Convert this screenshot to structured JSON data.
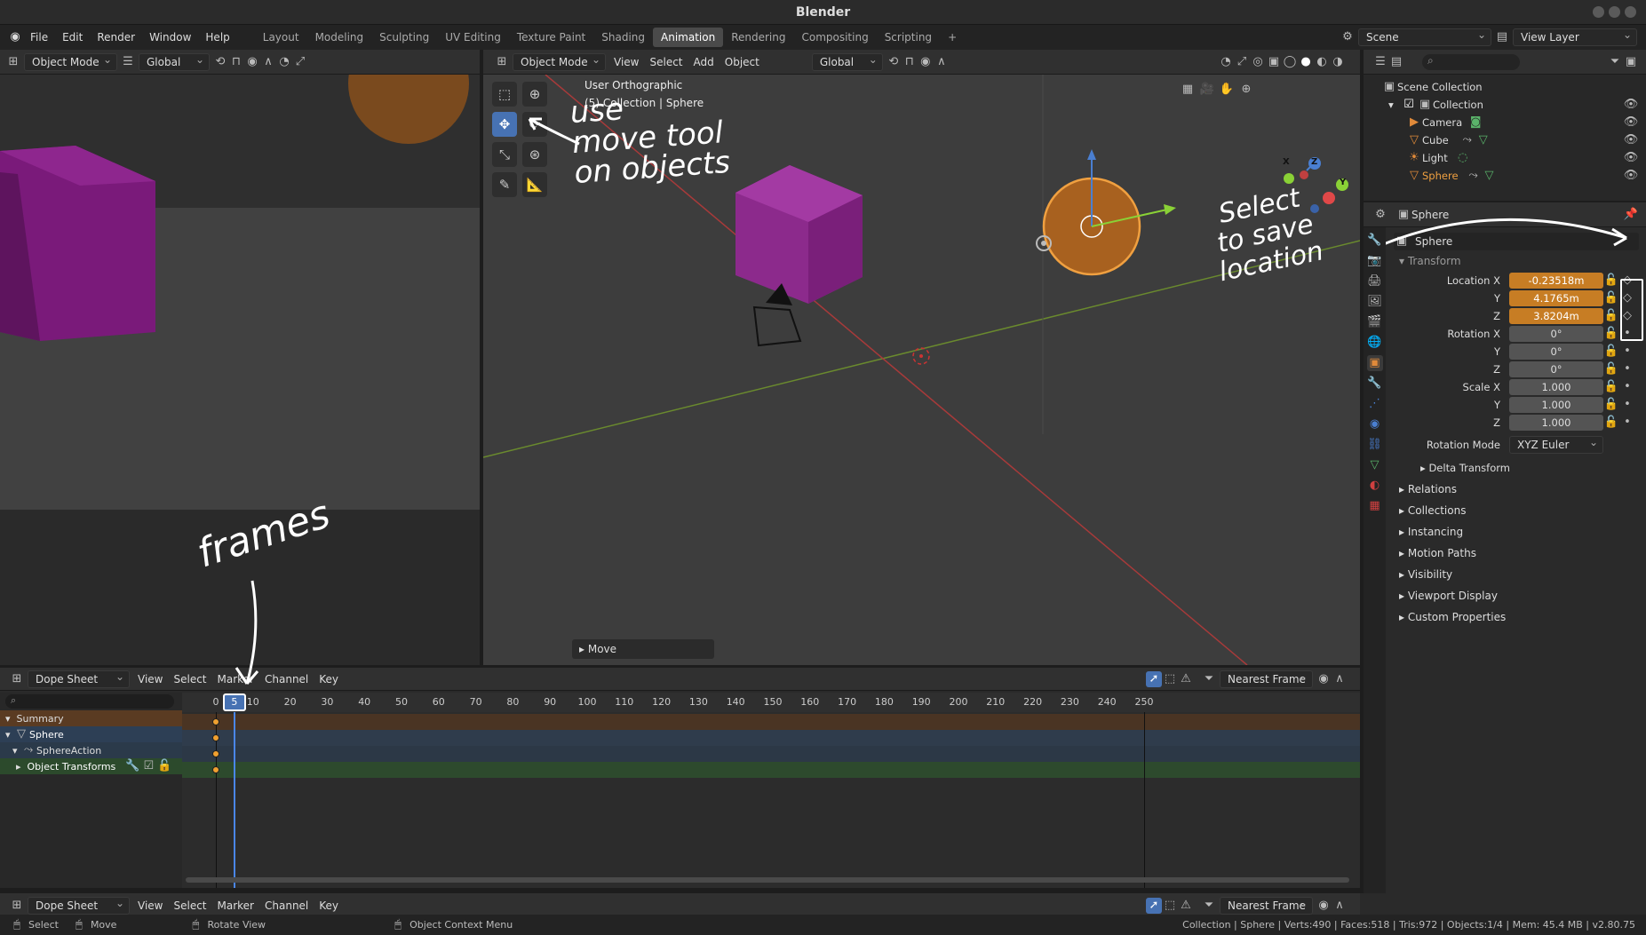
{
  "app": {
    "title": "Blender"
  },
  "menu": {
    "items": [
      "File",
      "Edit",
      "Render",
      "Window",
      "Help"
    ]
  },
  "workspaces": [
    "Layout",
    "Modeling",
    "Sculpting",
    "UV Editing",
    "Texture Paint",
    "Shading",
    "Animation",
    "Rendering",
    "Compositing",
    "Scripting"
  ],
  "active_workspace": "Animation",
  "scene": {
    "scene_name": "Scene",
    "view_layer": "View Layer"
  },
  "left_header": {
    "mode": "Object Mode",
    "orientation": "Global"
  },
  "viewport": {
    "mode": "Object Mode",
    "menus": [
      "View",
      "Select",
      "Add",
      "Object"
    ],
    "orientation": "Global",
    "view_name": "User Orthographic",
    "collection_info": "(5) Collection | Sphere",
    "last_operator": "Move",
    "gizmo_axes": [
      "X",
      "Y",
      "Z"
    ]
  },
  "outliner": {
    "root": "Scene Collection",
    "collection": "Collection",
    "objects": [
      "Camera",
      "Cube",
      "Light",
      "Sphere"
    ],
    "selected": "Sphere"
  },
  "properties": {
    "object_name": "Sphere",
    "datablock": "Sphere",
    "panel": "Transform",
    "location": {
      "label": "Location X",
      "x": "-0.23518m",
      "y": "4.1765m",
      "z": "3.8204m"
    },
    "rotation": {
      "label": "Rotation X",
      "x": "0°",
      "y": "0°",
      "z": "0°"
    },
    "scale": {
      "label": "Scale X",
      "x": "1.000",
      "y": "1.000",
      "z": "1.000"
    },
    "axis_y": "Y",
    "axis_z": "Z",
    "rotation_mode_label": "Rotation Mode",
    "rotation_mode": "XYZ Euler",
    "delta_transform": "Delta Transform",
    "sections": [
      "Relations",
      "Collections",
      "Instancing",
      "Motion Paths",
      "Visibility",
      "Viewport Display",
      "Custom Properties"
    ]
  },
  "dopesheet": {
    "editor": "Dope Sheet",
    "menus": [
      "View",
      "Select",
      "Marker",
      "Channel",
      "Key"
    ],
    "snap": "Nearest Frame",
    "current_frame": "5",
    "ticks": [
      "0",
      "10",
      "20",
      "30",
      "40",
      "50",
      "60",
      "70",
      "80",
      "90",
      "100",
      "110",
      "120",
      "130",
      "140",
      "150",
      "160",
      "170",
      "180",
      "190",
      "200",
      "210",
      "220",
      "230",
      "240",
      "250"
    ],
    "channels": [
      "Summary",
      "Sphere",
      "SphereAction",
      "Object Transforms"
    ]
  },
  "status": {
    "select": "Select",
    "move": "Move",
    "rotate": "Rotate View",
    "context": "Object Context Menu",
    "stats": "Collection | Sphere | Verts:490 | Faces:518 | Tris:972 | Objects:1/4 | Mem: 45.4 MB | v2.80.75"
  },
  "annotations": {
    "move_tool": [
      "use",
      "move tool",
      "on objects"
    ],
    "save_location": [
      "Select",
      "to save",
      "location"
    ],
    "frames": "frames"
  },
  "colors": {
    "accent": "#4772b3",
    "keyframe": "#c77d24",
    "selected": "#f0a040"
  }
}
